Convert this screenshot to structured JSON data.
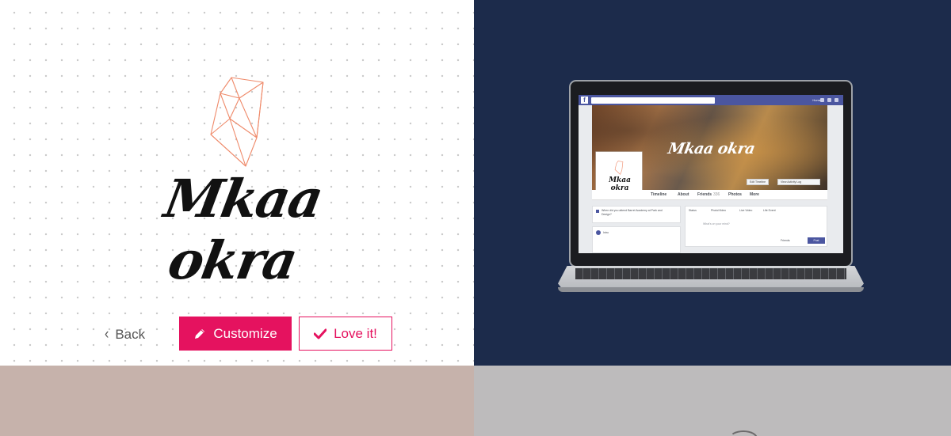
{
  "brand": {
    "name": "Mkaa okra",
    "accent_color": "#e5125f",
    "logo_icon": "geometric-gem-icon"
  },
  "actions": {
    "back_label": "Back",
    "back_icon": "chevron-left-icon",
    "customize_label": "Customize",
    "customize_icon": "pencil-icon",
    "love_label": "Love it!",
    "love_icon": "checkmark-icon"
  },
  "mockup": {
    "type": "facebook-cover-on-laptop",
    "cover_title": "Mkaa okra",
    "profile_title": "Mkaa okra",
    "top_user": "Home",
    "cover_buttons": [
      "Edit Timeline",
      "View Activity Log"
    ],
    "tabs": [
      "Timeline",
      "About",
      "Friends",
      "Photos",
      "More"
    ],
    "friends_count": "336",
    "status_tabs": [
      "Status",
      "Photo/Video",
      "Live Video",
      "Life Event"
    ],
    "status_placeholder": "What's on your mind?",
    "left_card_text": "When did you attend Barrel Academy at Park and Design?",
    "intro_label": "Intro",
    "audience_label": "Friends",
    "post_label": "Post",
    "background_color": "#1c2b4b"
  },
  "panels": {
    "bottom_left_color": "#c6b2ab",
    "bottom_right_color": "#bdbbbc"
  }
}
